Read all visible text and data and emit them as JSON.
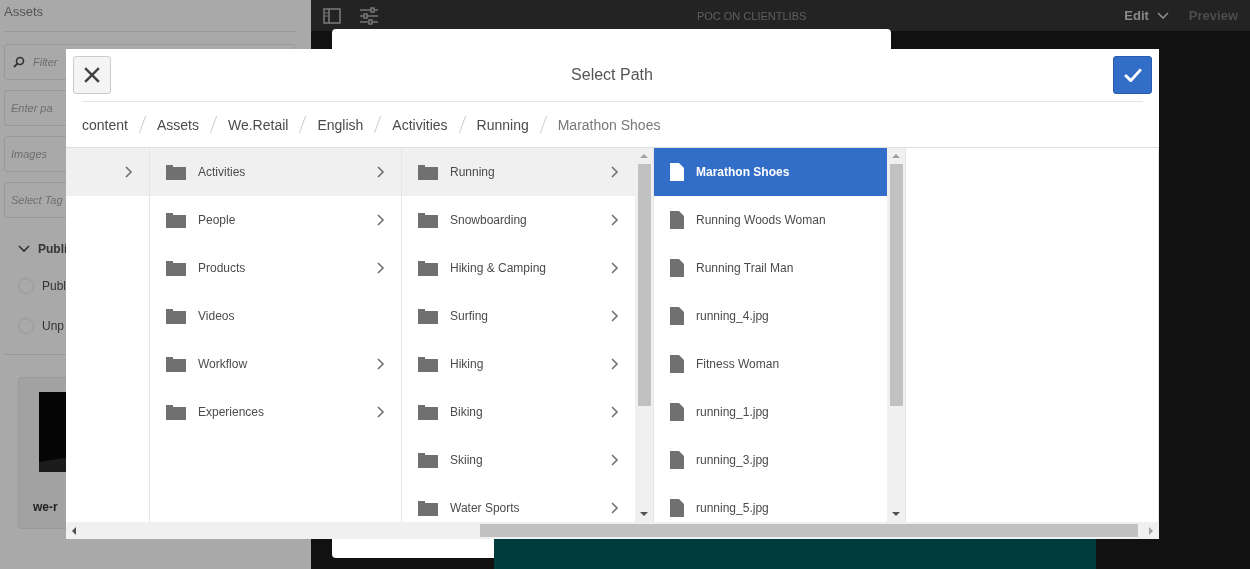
{
  "background": {
    "sidebar": {
      "title": "Assets",
      "fields": [
        {
          "kind": "search",
          "placeholder": "Filter"
        },
        {
          "kind": "text",
          "placeholder": "Enter pa"
        },
        {
          "kind": "text",
          "placeholder": "Images"
        },
        {
          "kind": "text",
          "placeholder": "Select Tag"
        }
      ],
      "section": {
        "label": "Publi",
        "expanded": true,
        "options": [
          {
            "label": "Publ",
            "checked": false
          },
          {
            "label": "Unp",
            "checked": false
          }
        ]
      },
      "card": {
        "kind": "picture",
        "name": "we-r"
      }
    },
    "topbar": {
      "title": "POC ON CLIENTLIBS",
      "edit": "Edit",
      "preview": "Preview"
    }
  },
  "dialog": {
    "title": "Select Path",
    "breadcrumb": [
      "content",
      "Assets",
      "We.Retail",
      "English",
      "Activities",
      "Running",
      "Marathon Shoes"
    ],
    "columns": [
      {
        "items": [
          {
            "kind": "root",
            "selected": true,
            "has_children": true
          }
        ]
      },
      {
        "items": [
          {
            "kind": "folder",
            "label": "Activities",
            "selected": true,
            "has_children": true
          },
          {
            "kind": "folder",
            "label": "People",
            "selected": false,
            "has_children": true
          },
          {
            "kind": "folder",
            "label": "Products",
            "selected": false,
            "has_children": true
          },
          {
            "kind": "folder",
            "label": "Videos",
            "selected": false,
            "has_children": false
          },
          {
            "kind": "folder",
            "label": "Workflow",
            "selected": false,
            "has_children": true
          },
          {
            "kind": "folder",
            "label": "Experiences",
            "selected": false,
            "has_children": true
          }
        ]
      },
      {
        "scroll": true,
        "items": [
          {
            "kind": "folder",
            "label": "Running",
            "selected": true,
            "has_children": true
          },
          {
            "kind": "folder",
            "label": "Snowboarding",
            "selected": false,
            "has_children": true
          },
          {
            "kind": "folder",
            "label": "Hiking & Camping",
            "selected": false,
            "has_children": true
          },
          {
            "kind": "folder",
            "label": "Surfing",
            "selected": false,
            "has_children": true
          },
          {
            "kind": "folder",
            "label": "Hiking",
            "selected": false,
            "has_children": true
          },
          {
            "kind": "folder",
            "label": "Biking",
            "selected": false,
            "has_children": true
          },
          {
            "kind": "folder",
            "label": "Skiing",
            "selected": false,
            "has_children": true
          },
          {
            "kind": "folder",
            "label": "Water Sports",
            "selected": false,
            "has_children": true
          }
        ]
      },
      {
        "scroll": true,
        "items": [
          {
            "kind": "file",
            "label": "Marathon Shoes",
            "selected": true,
            "has_children": false
          },
          {
            "kind": "file",
            "label": "Running Woods Woman",
            "selected": false,
            "has_children": false
          },
          {
            "kind": "file",
            "label": "Running Trail Man",
            "selected": false,
            "has_children": false
          },
          {
            "kind": "file",
            "label": "running_4.jpg",
            "selected": false,
            "has_children": false
          },
          {
            "kind": "file",
            "label": "Fitness Woman",
            "selected": false,
            "has_children": false
          },
          {
            "kind": "file",
            "label": "running_1.jpg",
            "selected": false,
            "has_children": false
          },
          {
            "kind": "file",
            "label": "running_3.jpg",
            "selected": false,
            "has_children": false
          },
          {
            "kind": "file",
            "label": "running_5.jpg",
            "selected": false,
            "has_children": false
          }
        ]
      }
    ]
  }
}
